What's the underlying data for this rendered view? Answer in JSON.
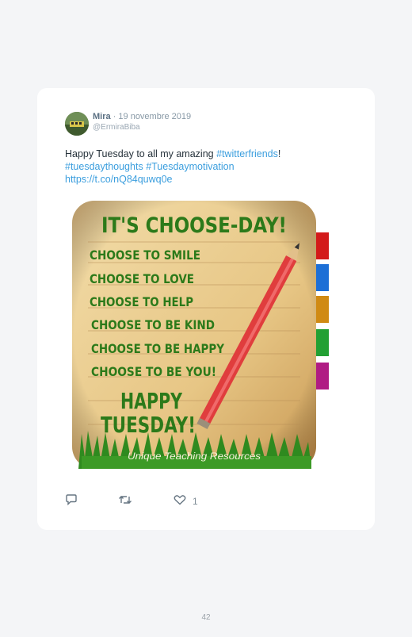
{
  "tweet": {
    "author_name": "Mira",
    "separator": " · ",
    "date": "19 novembre 2019",
    "handle": "@ErmiraBiba",
    "text_before": "Happy Tuesday to all my amazing ",
    "hashtag_1": "#twitterfriends",
    "text_after": "!",
    "hashtag_2": "#tuesdaythoughts",
    "hashtag_3": "#Tuesdaymotivation",
    "url": "https://t.co/nQ84quwq0e",
    "like_count": "1"
  },
  "image": {
    "title": "IT'S CHOOSE-DAY!",
    "lines": [
      "CHOOSE TO SMILE",
      "CHOOSE TO LOVE",
      "CHOOSE TO HELP",
      "CHOOSE TO BE KIND",
      "CHOOSE TO BE HAPPY",
      "CHOOSE TO BE YOU!"
    ],
    "footer_1": "HAPPY",
    "footer_2": "TUESDAY!",
    "credit": "Unique Teaching Resources"
  },
  "icons": {
    "reply": "reply-icon",
    "retweet": "retweet-icon",
    "like": "heart-icon"
  },
  "colors": {
    "link": "#3b9ede",
    "marker_green": "#2c7a1a"
  },
  "page": {
    "number": "42"
  }
}
